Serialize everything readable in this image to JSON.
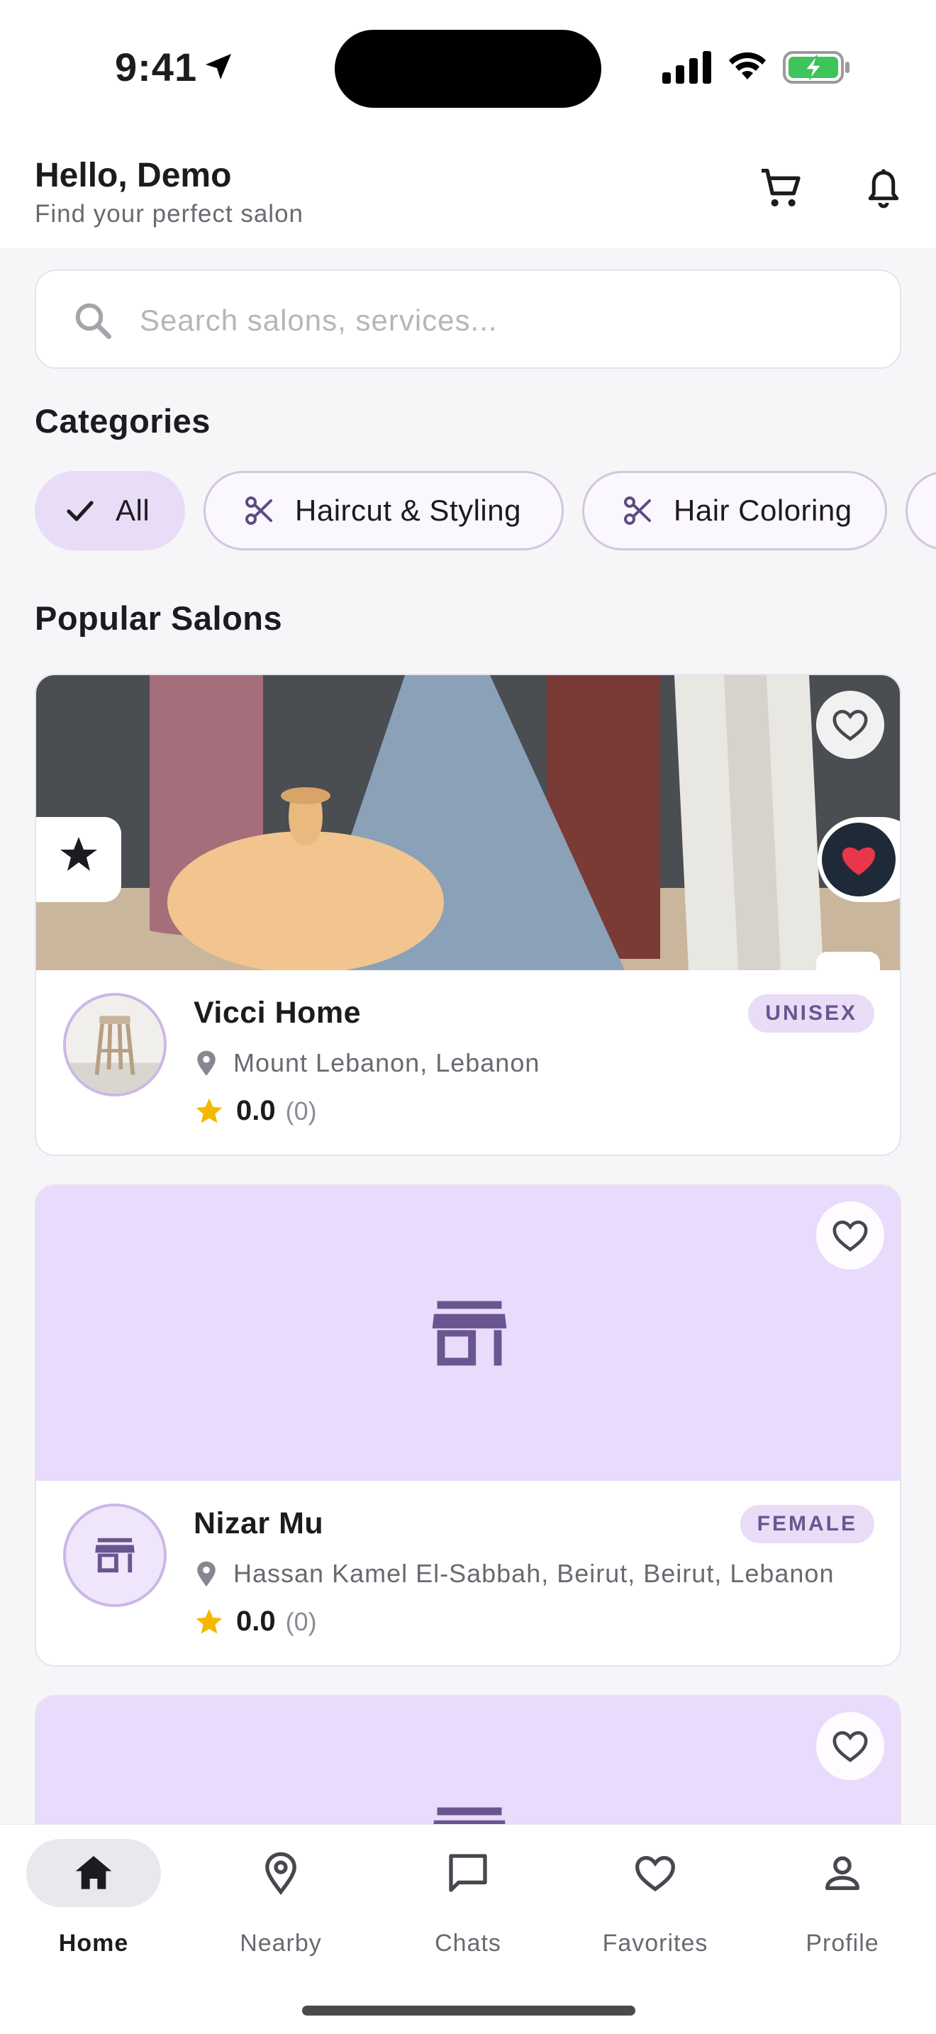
{
  "status_bar": {
    "time": "9:41"
  },
  "header": {
    "greeting": "Hello, Demo",
    "subtitle": "Find your perfect salon",
    "cart_icon": "cart-icon",
    "bell_icon": "bell-icon"
  },
  "search": {
    "placeholder": "Search salons, services..."
  },
  "categories": {
    "title": "Categories",
    "items": [
      {
        "label": "All",
        "selected": true,
        "icon": "check-icon"
      },
      {
        "label": "Haircut & Styling",
        "selected": false,
        "icon": "scissors-icon"
      },
      {
        "label": "Hair Coloring",
        "selected": false,
        "icon": "scissors-icon"
      }
    ]
  },
  "popular": {
    "title": "Popular Salons",
    "salons": [
      {
        "name": "Vicci Home",
        "badge": "UNISEX",
        "address": "Mount Lebanon, Lebanon",
        "rating": "0.0",
        "reviews": "(0)"
      },
      {
        "name": "Nizar Mu",
        "badge": "FEMALE",
        "address": "Hassan Kamel El-Sabbah, Beirut, Beirut, Lebanon",
        "rating": "0.0",
        "reviews": "(0)"
      }
    ]
  },
  "bottom_nav": {
    "items": [
      {
        "label": "Home",
        "active": true
      },
      {
        "label": "Nearby",
        "active": false
      },
      {
        "label": "Chats",
        "active": false
      },
      {
        "label": "Favorites",
        "active": false
      },
      {
        "label": "Profile",
        "active": false
      }
    ]
  },
  "colors": {
    "accent_light": "#e8dcf7",
    "accent_dark": "#6b5590",
    "star": "#f5b800",
    "placeholder_bg": "#e9dbfb"
  }
}
